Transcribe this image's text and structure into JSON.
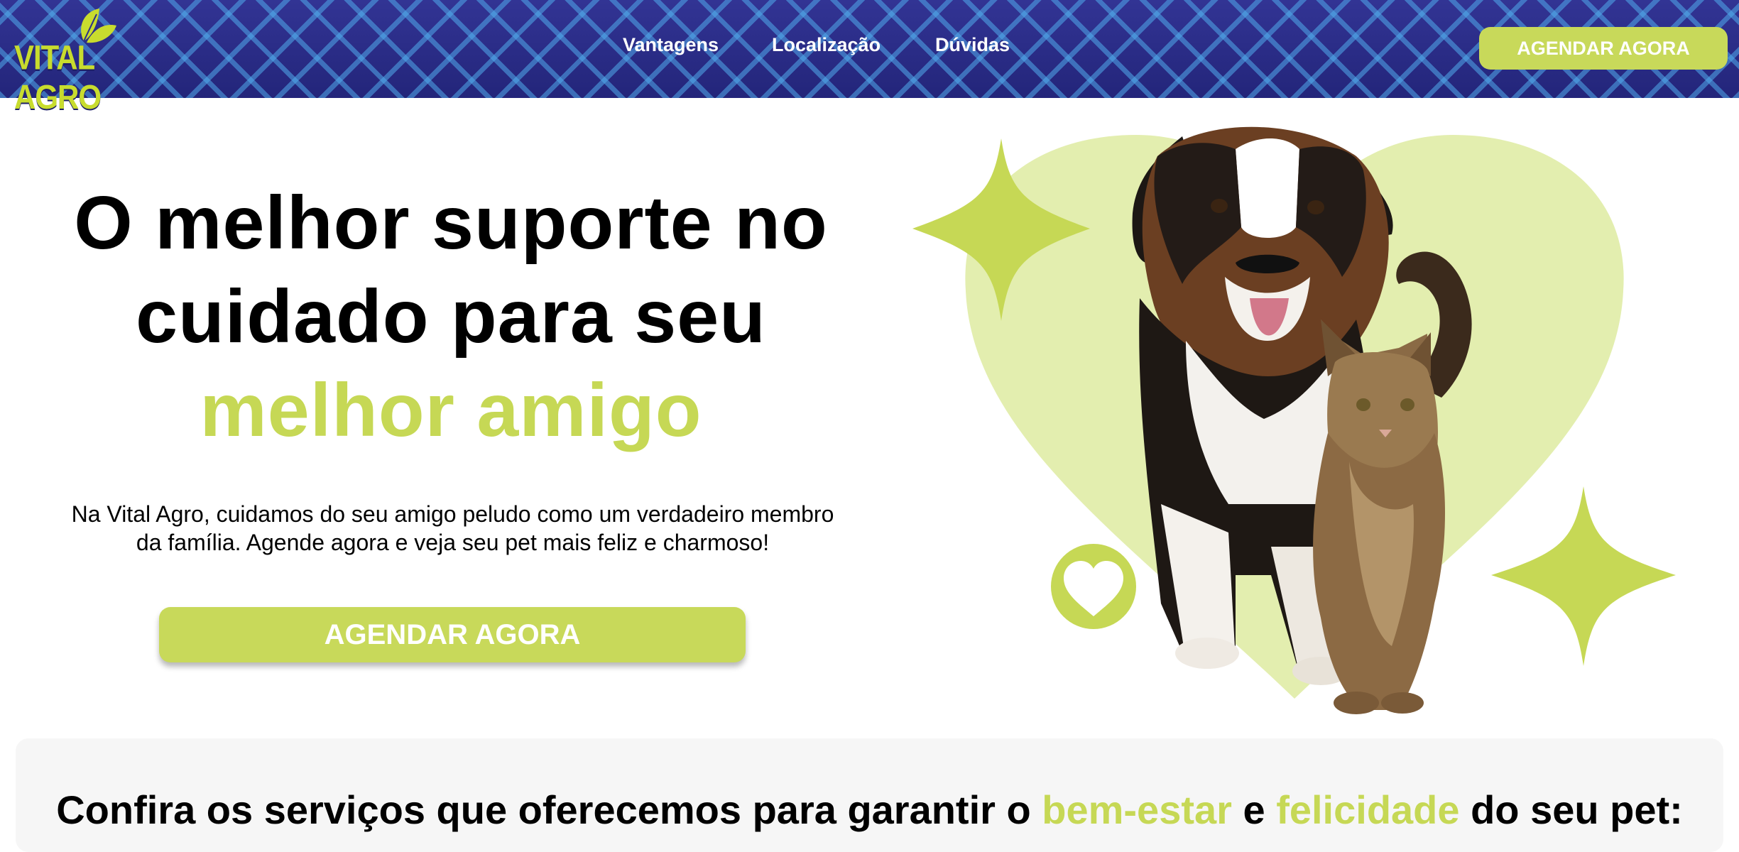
{
  "header": {
    "logo_text": "VITAL AGRO",
    "nav": [
      "Vantagens",
      "Localização",
      "Dúvidas"
    ],
    "cta_label": "AGENDAR AGORA"
  },
  "hero": {
    "title_line1": "O melhor suporte no",
    "title_line2": "cuidado para seu",
    "title_accent": "melhor amigo",
    "description_line1": "Na Vital Agro, cuidamos do seu amigo peludo como um verdadeiro membro",
    "description_line2": "da família. Agende agora e veja seu pet mais feliz e charmoso!",
    "cta_label": "AGENDAR AGORA"
  },
  "services": {
    "title_part1": "Confira os serviços que oferecemos para garantir o ",
    "title_hl1": "bem-estar",
    "title_part2": " e ",
    "title_hl2": "felicidade",
    "title_part3": " do seu pet:"
  },
  "colors": {
    "accent": "#c6d855",
    "header_bg": "#2b2e8c",
    "light_green": "#e3eeaf"
  },
  "icons": [
    "leaf-icon",
    "heart-icon",
    "sparkle-icon"
  ]
}
